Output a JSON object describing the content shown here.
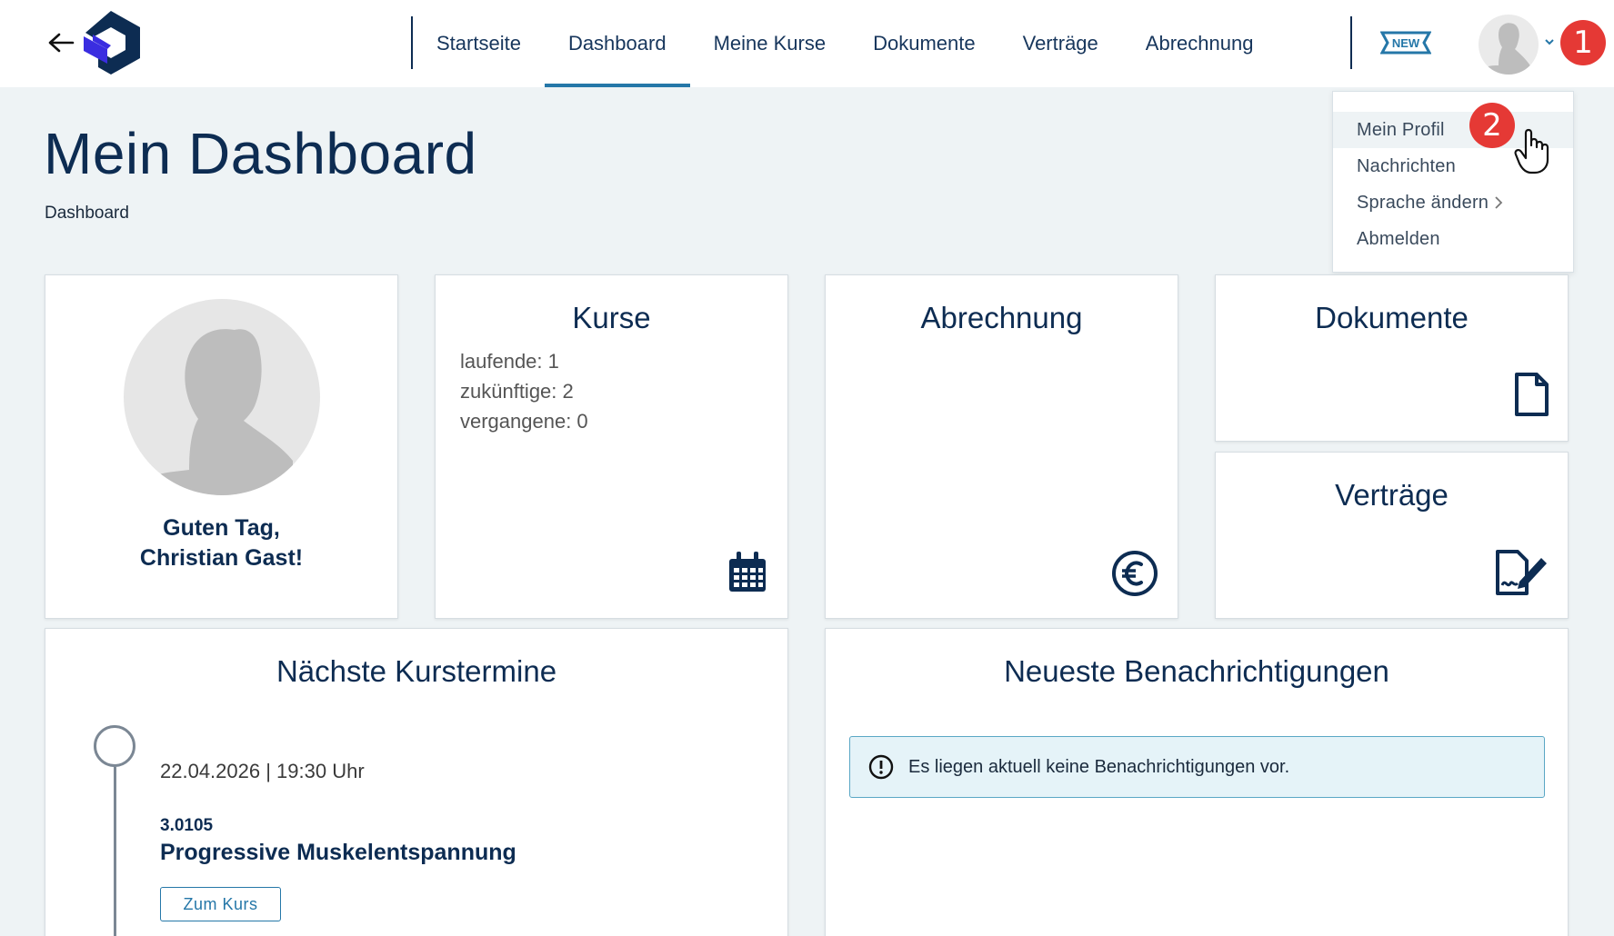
{
  "header": {
    "nav": [
      {
        "label": "Startseite",
        "active": false
      },
      {
        "label": "Dashboard",
        "active": true
      },
      {
        "label": "Meine Kurse",
        "active": false
      },
      {
        "label": "Dokumente",
        "active": false
      },
      {
        "label": "Verträge",
        "active": false
      },
      {
        "label": "Abrechnung",
        "active": false
      }
    ],
    "new_badge": "NEW",
    "step_badges": [
      "1",
      "2"
    ]
  },
  "dropdown": {
    "items": [
      "Mein Profil",
      "Nachrichten",
      "Sprache ändern",
      "Abmelden"
    ]
  },
  "page": {
    "title": "Mein Dashboard",
    "breadcrumb": "Dashboard"
  },
  "cards": {
    "profile": {
      "greeting_line1": "Guten Tag,",
      "greeting_line2": "Christian Gast!"
    },
    "kurse": {
      "title": "Kurse",
      "stats": [
        "laufende: 1",
        "zukünftige: 2",
        "vergangene: 0"
      ]
    },
    "abrechnung": {
      "title": "Abrechnung"
    },
    "dokumente": {
      "title": "Dokumente"
    },
    "vertraege": {
      "title": "Verträge"
    },
    "kurstermine": {
      "title": "Nächste Kurstermine",
      "entries": [
        {
          "date": "22.04.2026 | 19:30 Uhr",
          "number": "3.0105",
          "name": "Progressive Muskelentspannung",
          "button": "Zum Kurs"
        }
      ]
    },
    "benachrichtigungen": {
      "title": "Neueste Benachrichtigungen",
      "info": "Es liegen aktuell keine Benachrichtigungen vor."
    }
  },
  "colors": {
    "primary": "#0d2c52",
    "accent": "#2577a8",
    "badge": "#e53935",
    "background": "#eef3f5"
  },
  "icons": [
    "back-arrow-icon",
    "logo-icon",
    "new-badge-icon",
    "avatar-icon",
    "chevron-down-icon",
    "chevron-right-icon",
    "calendar-icon",
    "euro-icon",
    "document-icon",
    "contract-signature-icon",
    "info-icon",
    "hand-cursor-icon"
  ]
}
